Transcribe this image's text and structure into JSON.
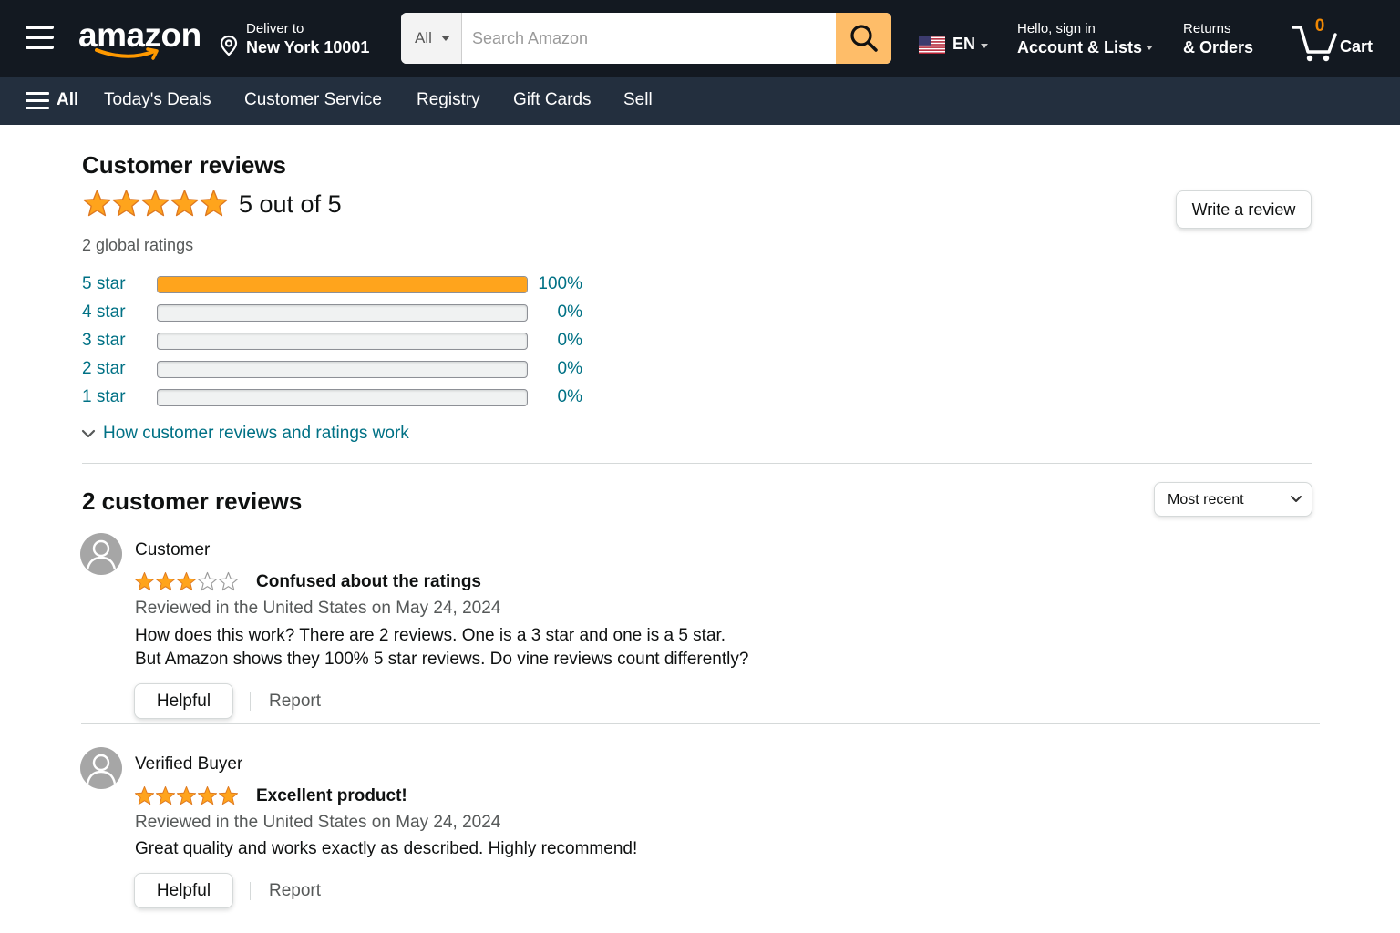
{
  "header": {
    "logo_text": "amazon",
    "deliver": {
      "line1": "Deliver to",
      "line2": "New York 10001"
    },
    "search": {
      "category": "All",
      "placeholder": "Search Amazon"
    },
    "language": {
      "code": "EN"
    },
    "account": {
      "line1": "Hello, sign in",
      "line2": "Account & Lists"
    },
    "returns": {
      "line1": "Returns",
      "line2": "& Orders"
    },
    "cart": {
      "count": "0",
      "label": "Cart"
    },
    "colors": {
      "nav_bg": "#131921",
      "subnav_bg": "#232f3e",
      "search_button": "#febd69",
      "cart_count": "#f08804"
    }
  },
  "subnav": {
    "all_label": "All",
    "items": [
      "Today's Deals",
      "Customer Service",
      "Registry",
      "Gift Cards",
      "Sell"
    ]
  },
  "summary": {
    "heading": "Customer reviews",
    "rating": 5,
    "rating_text": "5 out of 5",
    "global_ratings": "2 global ratings",
    "write_review": "Write a review",
    "histogram": [
      {
        "label": "5 star",
        "percent_text": "100%",
        "percent": 100
      },
      {
        "label": "4 star",
        "percent_text": "0%",
        "percent": 0
      },
      {
        "label": "3 star",
        "percent_text": "0%",
        "percent": 0
      },
      {
        "label": "2 star",
        "percent_text": "0%",
        "percent": 0
      },
      {
        "label": "1 star",
        "percent_text": "0%",
        "percent": 0
      }
    ],
    "how_it_works": "How customer reviews and ratings work",
    "colors": {
      "star": "#ffa41c",
      "link": "#007185"
    }
  },
  "reviews_section": {
    "heading": "2 customer reviews",
    "sort_label": "Most recent",
    "reviews": [
      {
        "reviewer": "Customer",
        "stars": 3,
        "title": "Confused about the ratings",
        "date": "Reviewed in the United States on May 24, 2024",
        "body_lines": [
          "How does this work? There are 2 reviews. One is a 3 star and one is a 5 star.",
          "But Amazon shows they 100% 5 star reviews. Do vine reviews count differently?"
        ],
        "helpful": "Helpful",
        "report": "Report"
      },
      {
        "reviewer": "Verified Buyer",
        "stars": 5,
        "title": "Excellent product!",
        "date": "Reviewed in the United States on May 24, 2024",
        "body_lines": [
          "Great quality and works exactly as described. Highly recommend!"
        ],
        "helpful": "Helpful",
        "report": "Report"
      }
    ]
  }
}
